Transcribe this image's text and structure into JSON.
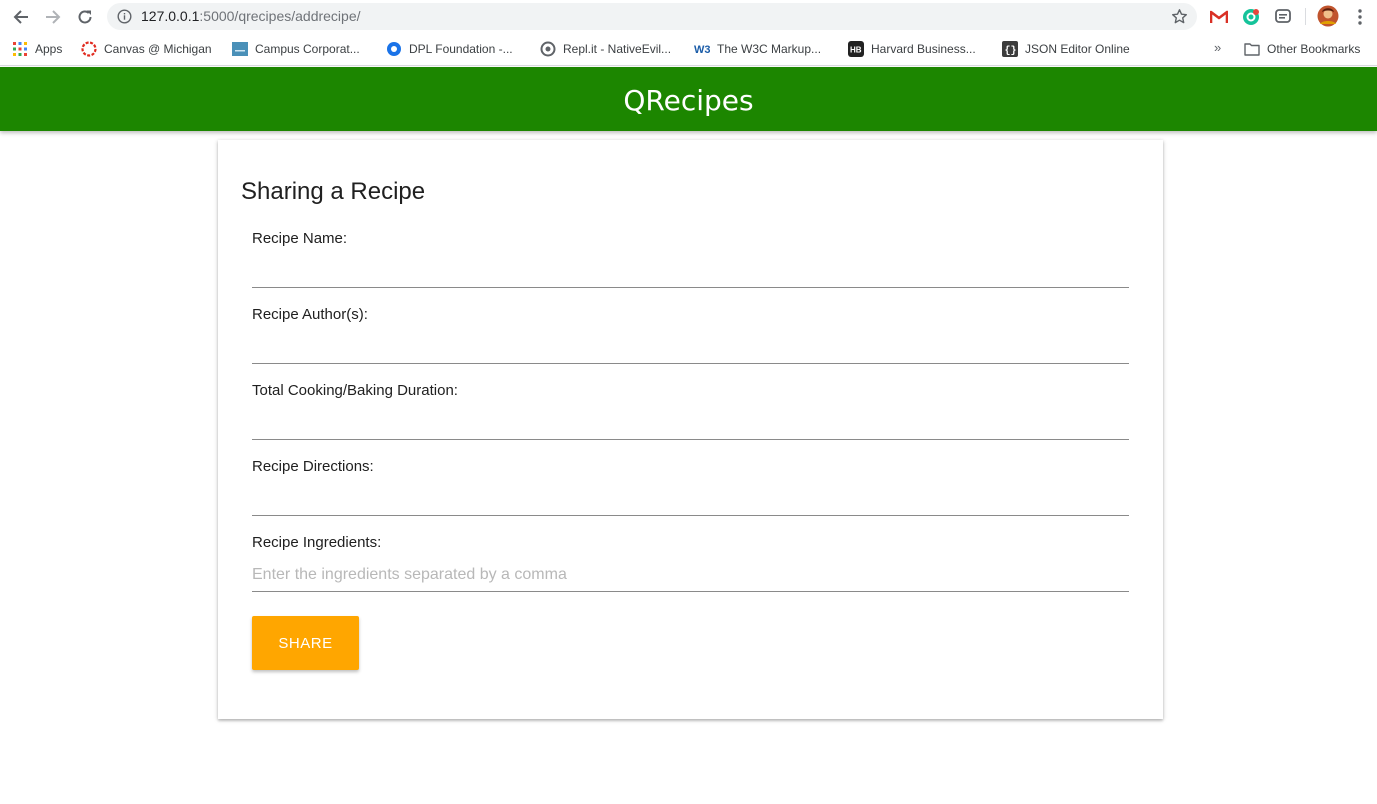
{
  "browser": {
    "url_host": "127.0.0.1",
    "url_rest": ":5000/qrecipes/addrecipe/",
    "bookmarks": [
      {
        "label": "Apps",
        "icon": "apps-grid-icon"
      },
      {
        "label": "Canvas @ Michigan",
        "icon": "canvas-icon"
      },
      {
        "label": "Campus Corporat...",
        "icon": "campus-icon"
      },
      {
        "label": "DPL Foundation -...",
        "icon": "dpl-icon"
      },
      {
        "label": "Repl.it - NativeEvil...",
        "icon": "replit-icon"
      },
      {
        "label": "The W3C Markup...",
        "icon": "w3c-icon"
      },
      {
        "label": "Harvard Business...",
        "icon": "hbr-icon"
      },
      {
        "label": "JSON Editor Online",
        "icon": "json-editor-icon"
      }
    ],
    "other_bookmarks": "Other Bookmarks",
    "overflow_chevron": "»"
  },
  "header": {
    "title": "QRecipes",
    "color": "#1c8600"
  },
  "form": {
    "title": "Sharing a Recipe",
    "fields": [
      {
        "label": "Recipe Name:",
        "value": "",
        "placeholder": ""
      },
      {
        "label": "Recipe Author(s):",
        "value": "",
        "placeholder": ""
      },
      {
        "label": "Total Cooking/Baking Duration:",
        "value": "",
        "placeholder": ""
      },
      {
        "label": "Recipe Directions:",
        "value": "",
        "placeholder": ""
      },
      {
        "label": "Recipe Ingredients:",
        "value": "",
        "placeholder": "Enter the ingredients separated by a comma"
      }
    ],
    "submit_label": "SHARE",
    "submit_color": "#ffa600"
  }
}
